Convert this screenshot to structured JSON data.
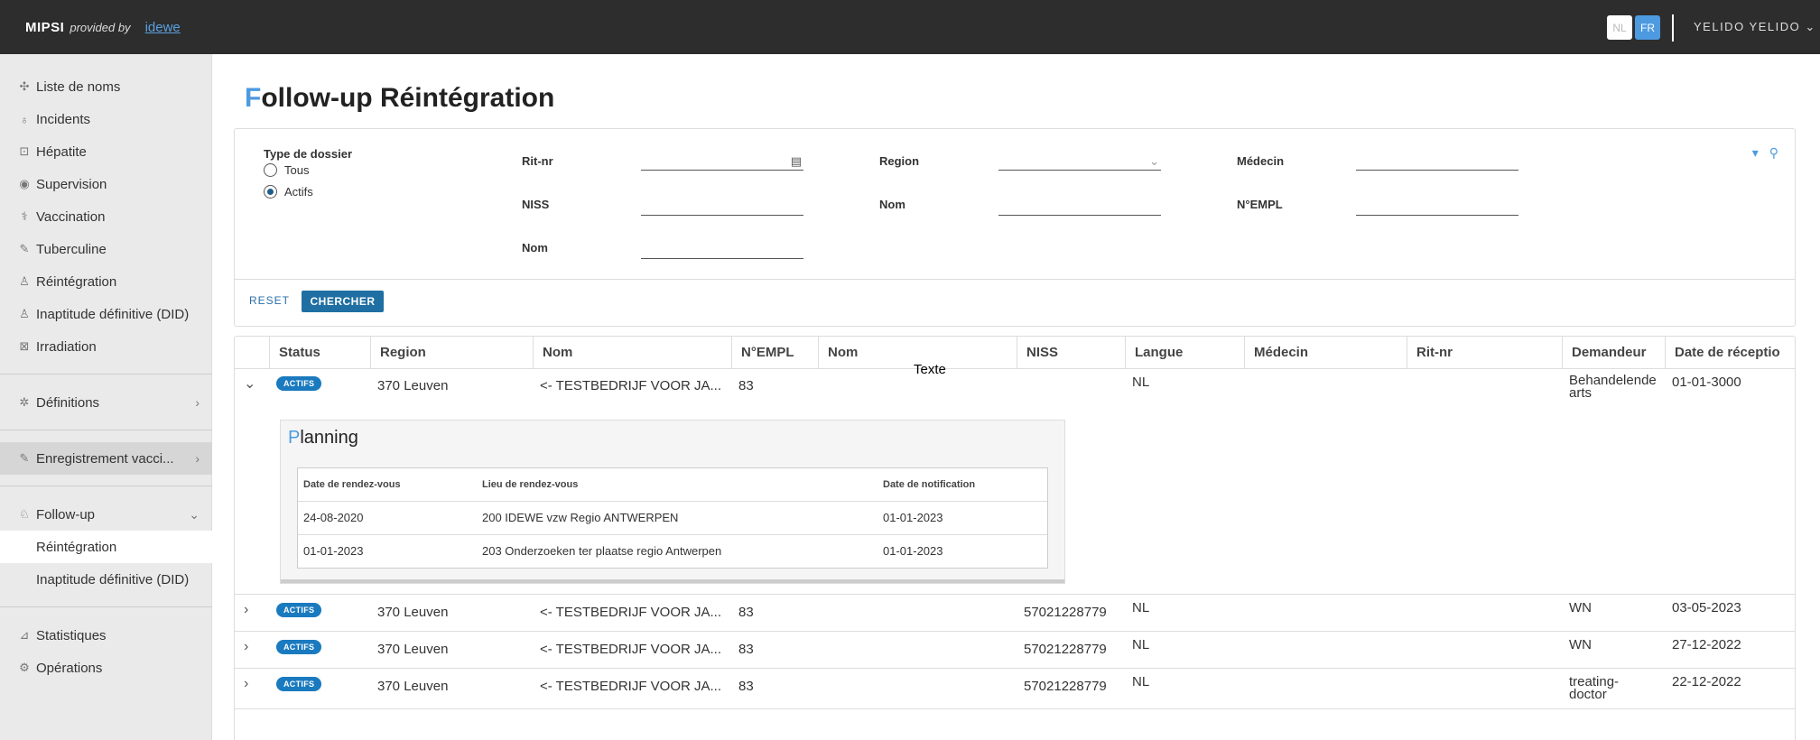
{
  "header": {
    "logo_mipsi": "MIPSI",
    "logo_provided": "provided by",
    "logo_idewe": "idewe",
    "lang_nl": "NL",
    "lang_fr": "FR",
    "user_name": "YELIDO YELIDO"
  },
  "sidebar": {
    "items": [
      {
        "label": "Liste de noms",
        "icon": "list-icon"
      },
      {
        "label": "Incidents",
        "icon": "incident-icon"
      },
      {
        "label": "Hépatite",
        "icon": "hepatitis-icon"
      },
      {
        "label": "Supervision",
        "icon": "eye-icon"
      },
      {
        "label": "Vaccination",
        "icon": "vaccine-icon"
      },
      {
        "label": "Tuberculine",
        "icon": "syringe-icon"
      },
      {
        "label": "Réintégration",
        "icon": "person-icon"
      },
      {
        "label": "Inaptitude définitive (DID)",
        "icon": "person-icon"
      },
      {
        "label": "Irradiation",
        "icon": "radiation-icon"
      }
    ],
    "definitions": "Définitions",
    "enregistrement": "Enregistrement vacci...",
    "followup": "Follow-up",
    "followup_sub": [
      "Réintégration",
      "Inaptitude définitive (DID)"
    ],
    "statistiques": "Statistiques",
    "operations": "Opérations"
  },
  "page": {
    "title_first": "F",
    "title_rest": "ollow-up Réintégration"
  },
  "filter": {
    "type_label": "Type de dossier",
    "radio_all": "Tous",
    "radio_active": "Actifs",
    "selected": "Actifs",
    "ritnr_label": "Rit-nr",
    "region_label": "Region",
    "medecin_label": "Médecin",
    "niss_label": "NISS",
    "nom_label": "Nom",
    "nempl_label": "N°EMPL",
    "nom2_label": "Nom",
    "reset_label": "RESET",
    "search_label": "CHERCHER"
  },
  "table": {
    "columns": [
      "Status",
      "Region",
      "Nom",
      "N°EMPL",
      "Nom",
      "NISS",
      "Langue",
      "Médecin",
      "Rit-nr",
      "Demandeur",
      "Date de réceptio"
    ],
    "overlay_text": "Texte",
    "rows": [
      {
        "status": "ACTIFS",
        "region": "370 Leuven",
        "nom": "<- TESTBEDRIJF VOOR JA...",
        "nempl": "83",
        "niss": "",
        "langue": "NL",
        "demandeur": "Behandelende arts",
        "date": "01-01-3000",
        "expanded": true
      },
      {
        "status": "ACTIFS",
        "region": "370 Leuven",
        "nom": "<- TESTBEDRIJF VOOR JA...",
        "nempl": "83",
        "niss": "57021228779",
        "langue": "NL",
        "demandeur": "WN",
        "date": "03-05-2023",
        "expanded": false
      },
      {
        "status": "ACTIFS",
        "region": "370 Leuven",
        "nom": "<- TESTBEDRIJF VOOR JA...",
        "nempl": "83",
        "niss": "57021228779",
        "langue": "NL",
        "demandeur": "WN",
        "date": "27-12-2022",
        "expanded": false
      },
      {
        "status": "ACTIFS",
        "region": "370 Leuven",
        "nom": "<- TESTBEDRIJF VOOR JA...",
        "nempl": "83",
        "niss": "57021228779",
        "langue": "NL",
        "demandeur": "treating-doctor",
        "date": "22-12-2022",
        "expanded": false
      }
    ]
  },
  "planning": {
    "title_first": "P",
    "title_rest": "lanning",
    "columns": [
      "Date de rendez-vous",
      "Lieu de rendez-vous",
      "Date de notification"
    ],
    "rows": [
      {
        "date": "24-08-2020",
        "lieu": "200 IDEWE vzw Regio ANTWERPEN",
        "notif": "01-01-2023"
      },
      {
        "date": "01-01-2023",
        "lieu": "203 Onderzoeken ter plaatse regio Antwerpen",
        "notif": "01-01-2023"
      }
    ]
  },
  "colors": {
    "accent": "#4d9ae0",
    "topbar": "#2d2d2d",
    "badge": "#1a7abf",
    "button": "#1f6fa3"
  }
}
